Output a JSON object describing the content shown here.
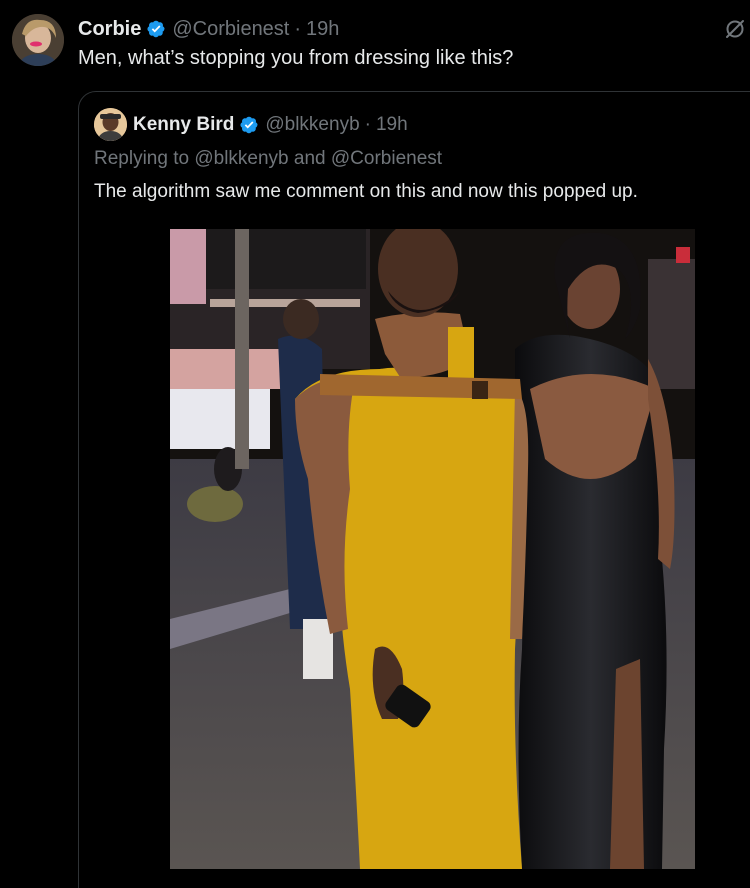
{
  "tweet": {
    "author_name": "Corbie",
    "author_handle": "@Corbienest",
    "dot": "·",
    "time": "19h",
    "text": "Men, what’s stopping you from dressing like this?"
  },
  "quoted": {
    "author_name": "Kenny Bird",
    "author_handle": "@blkkenyb",
    "dot": "·",
    "time": "19h",
    "reply_prefix": "Replying to",
    "reply_mention_1": "@blkkenyb",
    "reply_and": "and",
    "reply_mention_2": "@Corbienest",
    "text": "The algorithm saw me comment on this and now this popped up."
  },
  "icons": {
    "verified": "verified-badge-icon",
    "grok": "grok-icon"
  },
  "colors": {
    "background": "#000000",
    "text_primary": "#e7e9ea",
    "text_secondary": "#71767b",
    "verified": "#1d9bf0",
    "border": "#2f3336"
  }
}
